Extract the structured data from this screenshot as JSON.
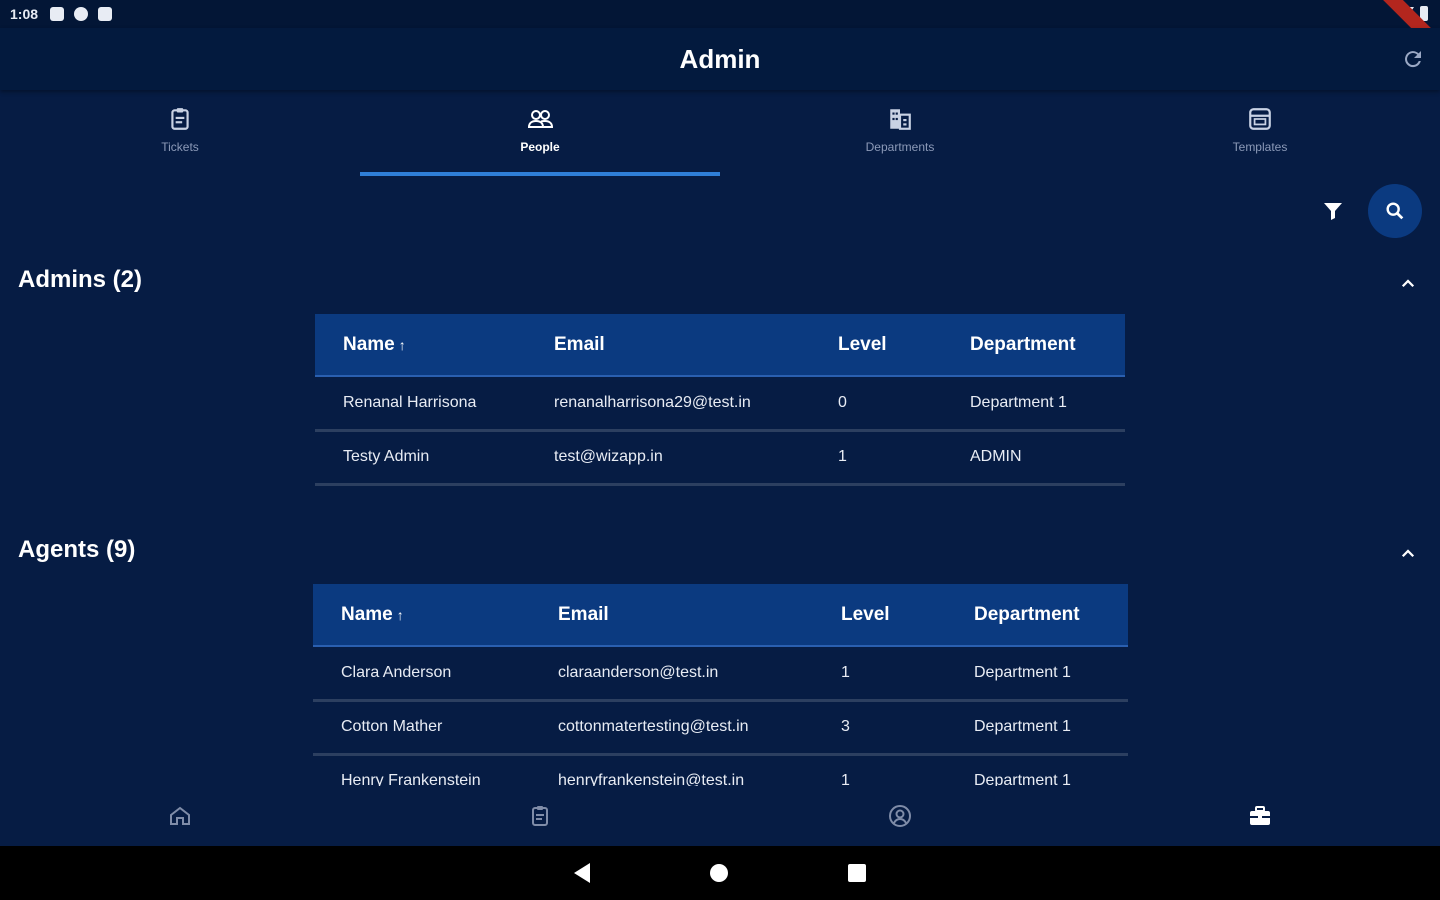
{
  "status_bar": {
    "time": "1:08"
  },
  "app_bar": {
    "title": "Admin"
  },
  "tabs": [
    {
      "label": "Tickets",
      "icon": "clipboard-icon",
      "active": false
    },
    {
      "label": "People",
      "icon": "people-icon",
      "active": true
    },
    {
      "label": "Departments",
      "icon": "building-icon",
      "active": false
    },
    {
      "label": "Templates",
      "icon": "template-icon",
      "active": false
    }
  ],
  "admins": {
    "title": "Admins (2)",
    "headers": {
      "name": "Name",
      "email": "Email",
      "level": "Level",
      "department": "Department"
    },
    "rows": [
      {
        "name": "Renanal Harrisona",
        "email": "renanalharrisona29@test.in",
        "level": "0",
        "department": "Department 1"
      },
      {
        "name": "Testy Admin",
        "email": "test@wizapp.in",
        "level": "1",
        "department": "ADMIN"
      }
    ]
  },
  "agents": {
    "title": "Agents (9)",
    "headers": {
      "name": "Name",
      "email": "Email",
      "level": "Level",
      "department": "Department"
    },
    "rows": [
      {
        "name": "Clara Anderson",
        "email": "claraanderson@test.in",
        "level": "1",
        "department": "Department 1"
      },
      {
        "name": "Cotton Mather",
        "email": "cottonmatertesting@test.in",
        "level": "3",
        "department": "Department 1"
      },
      {
        "name": "Henry Frankenstein",
        "email": "henryfrankenstein@test.in",
        "level": "1",
        "department": "Department 1"
      }
    ]
  },
  "colors": {
    "background": "#061c44",
    "app_bar": "#031a3e",
    "table_header": "#0b3a80",
    "tab_indicator": "#2f7fd8",
    "debug_banner": "#b3261e"
  },
  "bottom_nav": [
    {
      "icon": "home-icon"
    },
    {
      "icon": "clipboard-icon"
    },
    {
      "icon": "account-circle-icon"
    },
    {
      "icon": "toolbox-icon"
    }
  ]
}
